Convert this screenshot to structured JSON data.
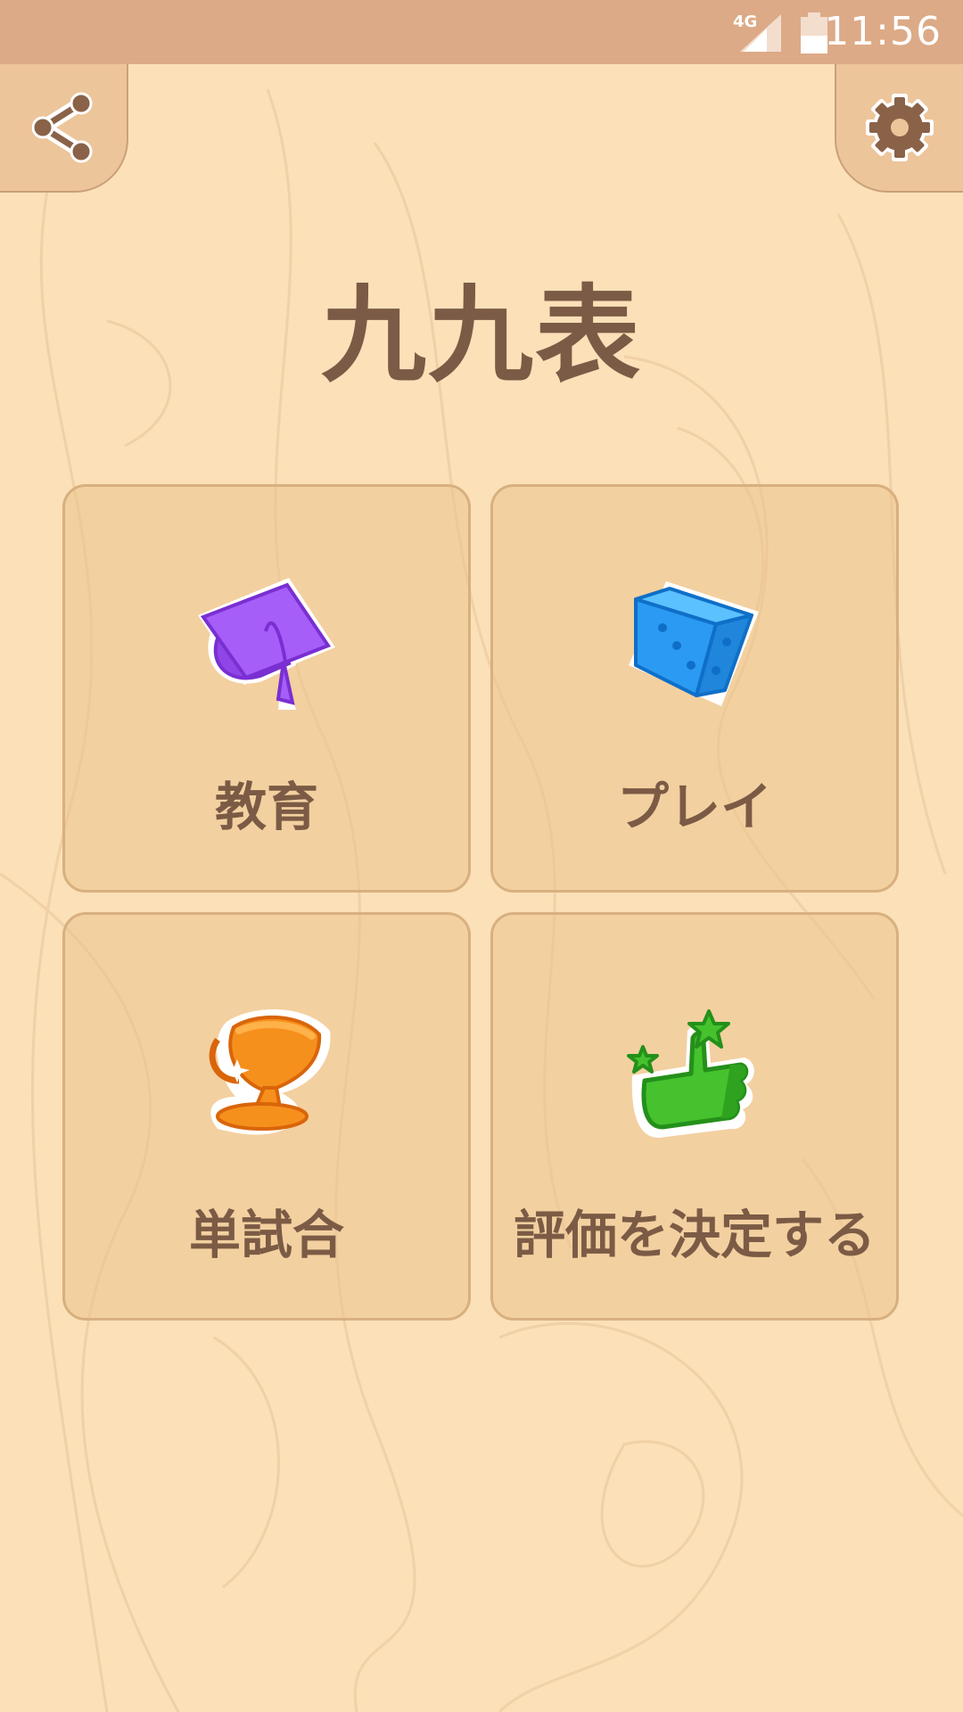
{
  "status_bar": {
    "network": "4G",
    "time": "11:56"
  },
  "header": {
    "share_icon": "share-icon",
    "settings_icon": "gear-icon"
  },
  "app_title": "九九表",
  "menu": {
    "education": {
      "label": "教育",
      "icon": "graduation-cap-icon",
      "color": "#a25ef7"
    },
    "play": {
      "label": "プレイ",
      "icon": "dice-icon",
      "color": "#2a9af2"
    },
    "match": {
      "label": "単試合",
      "icon": "trophy-icon",
      "color": "#f38b12"
    },
    "rate": {
      "label": "評価を決定する",
      "icon": "thumbs-up-icon",
      "color": "#45c22e"
    }
  },
  "colors": {
    "background": "#fbe0b8",
    "text": "#7b5b45",
    "status_bar": "#dcaa87"
  }
}
